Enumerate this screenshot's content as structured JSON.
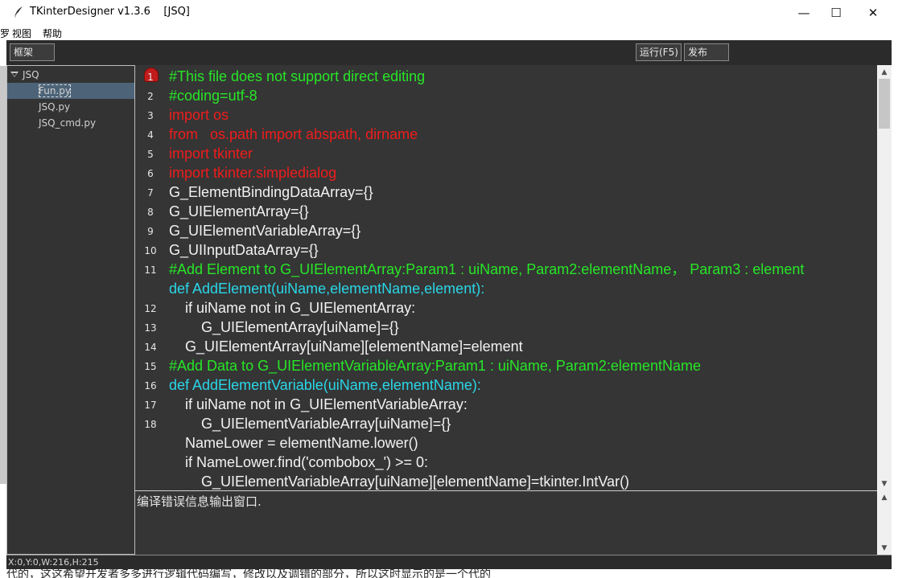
{
  "window": {
    "title": "TKinterDesigner v1.3.6    [JSQ]",
    "controls": {
      "minimize": "—",
      "maximize": "☐",
      "close": "✕"
    }
  },
  "menu": {
    "items": [
      "视图",
      "帮助"
    ],
    "cut_left": "罗"
  },
  "toolbar": {
    "frame_label": "框架",
    "run_label": "运行(F5)",
    "publish_label": "发布"
  },
  "tree": {
    "root": "JSQ",
    "files": [
      "Fun.py",
      "JSQ.py",
      "JSQ_cmd.py"
    ],
    "selected": "Fun.py"
  },
  "editor": {
    "line_numbers": [
      "1",
      "2",
      "3",
      "4",
      "5",
      "6",
      "7",
      "8",
      "9",
      "10",
      "11",
      "12",
      "13",
      "14",
      "15",
      "16",
      "17",
      "18"
    ],
    "lines": [
      {
        "text": "#This file does not support direct editing",
        "kind": "comment"
      },
      {
        "text": "#coding=utf-8",
        "kind": "comment"
      },
      {
        "text": "import os",
        "kind": "import"
      },
      {
        "text": "from   os.path import abspath, dirname",
        "kind": "import"
      },
      {
        "text": "import tkinter",
        "kind": "import"
      },
      {
        "text": "import tkinter.simpledialog",
        "kind": "import"
      },
      {
        "text": "G_ElementBindingDataArray={}",
        "kind": "plain"
      },
      {
        "text": "G_UIElementArray={}",
        "kind": "plain"
      },
      {
        "text": "G_UIElementVariableArray={}",
        "kind": "plain"
      },
      {
        "text": "G_UIInputDataArray={}",
        "kind": "plain"
      },
      {
        "text": "#Add Element to G_UIElementArray:Param1 : uiName, Param2:elementName， Param3 : element",
        "kind": "comment"
      },
      {
        "text": "def AddElement(uiName,elementName,element):",
        "kind": "def"
      },
      {
        "text": "    if uiName not in G_UIElementArray:",
        "kind": "plain"
      },
      {
        "text": "        G_UIElementArray[uiName]={}",
        "kind": "plain"
      },
      {
        "text": "    G_UIElementArray[uiName][elementName]=element",
        "kind": "plain"
      },
      {
        "text": "#Add Data to G_UIElementVariableArray:Param1 : uiName, Param2:elementName",
        "kind": "comment"
      },
      {
        "text": "def AddElementVariable(uiName,elementName):",
        "kind": "def"
      },
      {
        "text": "    if uiName not in G_UIElementVariableArray:",
        "kind": "plain"
      },
      {
        "text": "        G_UIElementVariableArray[uiName]={}",
        "kind": "plain"
      },
      {
        "text": "    NameLower = elementName.lower()",
        "kind": "plain"
      },
      {
        "text": "    if NameLower.find('combobox_') >= 0:",
        "kind": "plain"
      },
      {
        "text": "        G_UIElementVariableArray[uiName][elementName]=tkinter.IntVar()",
        "kind": "plain"
      }
    ]
  },
  "output": {
    "text": "编译错误信息输出窗口."
  },
  "status": {
    "text": "X:0,Y:0,W:216,H:215"
  },
  "background": {
    "bottom_text": "代的，这这希望开发者多多进行逻辑代码编写，修改以及调错的部分，所以这时显示的是一个代的"
  },
  "colors": {
    "comment": "#27e627",
    "import": "#ef1c1c",
    "def": "#2ad6e8",
    "plain": "#f2f2f2",
    "editor_bg": "#353535",
    "breakpoint": "#c21b1b"
  }
}
